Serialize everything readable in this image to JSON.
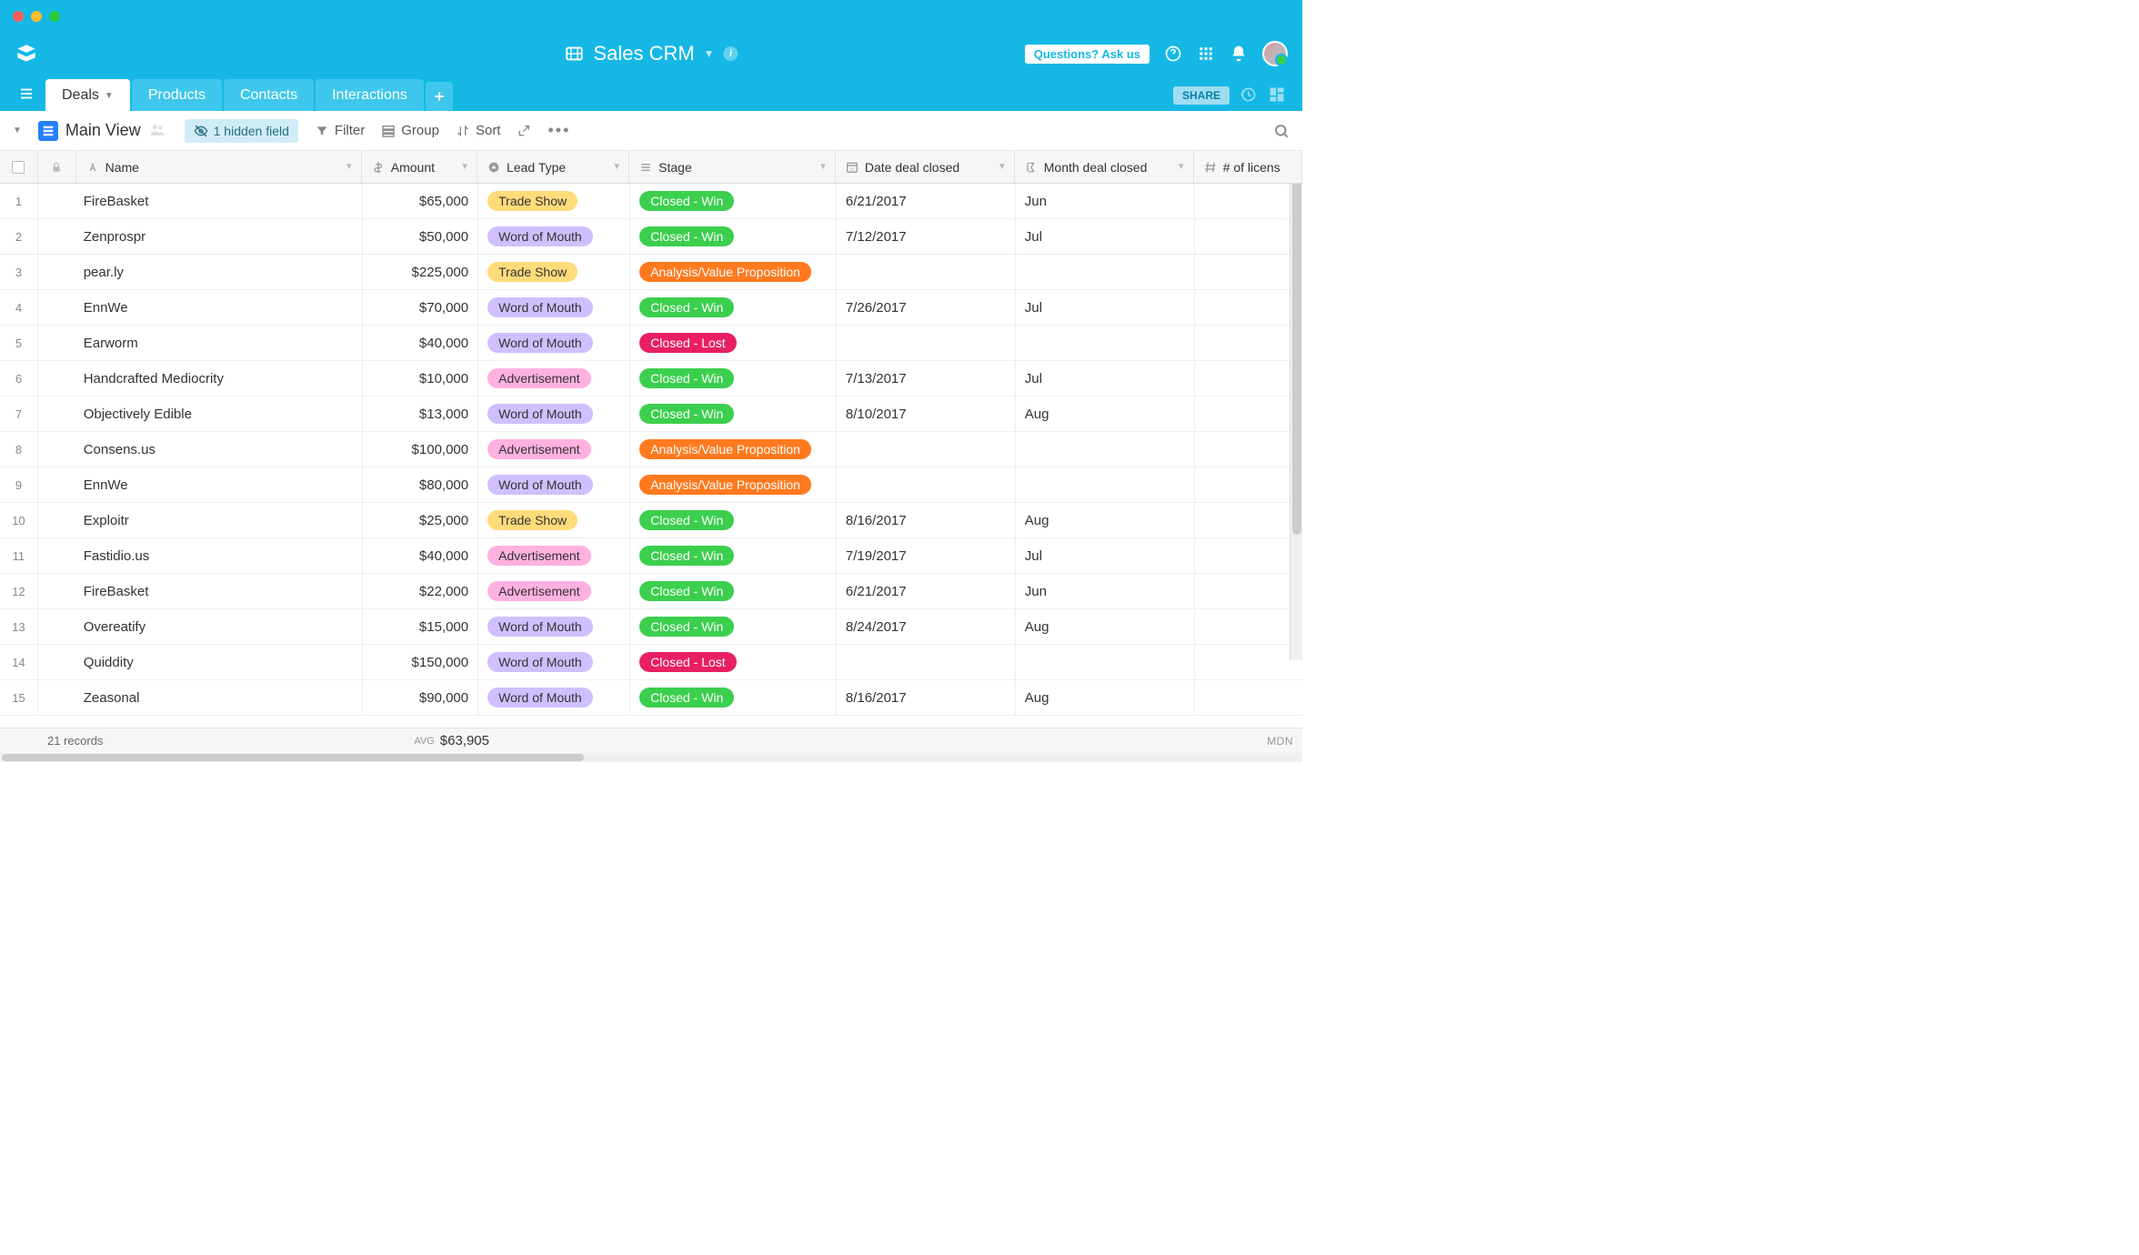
{
  "app_title": "Sales CRM",
  "questions_button": "Questions? Ask us",
  "tabs": [
    "Deals",
    "Products",
    "Contacts",
    "Interactions"
  ],
  "active_tab_index": 0,
  "share_label": "SHARE",
  "view_name": "Main View",
  "toolbar": {
    "hidden_field": "1 hidden field",
    "filter": "Filter",
    "group": "Group",
    "sort": "Sort"
  },
  "columns": {
    "name": "Name",
    "amount": "Amount",
    "lead_type": "Lead Type",
    "stage": "Stage",
    "date_closed": "Date deal closed",
    "month_closed": "Month deal closed",
    "licenses": "# of licens"
  },
  "lead_types": {
    "trade_show": {
      "label": "Trade Show",
      "color": "pill-yellow"
    },
    "word_of_mouth": {
      "label": "Word of Mouth",
      "color": "pill-purple"
    },
    "advertisement": {
      "label": "Advertisement",
      "color": "pill-pink"
    }
  },
  "stages": {
    "closed_win": {
      "label": "Closed ‑ Win",
      "color": "pill-green"
    },
    "closed_lost": {
      "label": "Closed ‑ Lost",
      "color": "pill-red"
    },
    "analysis": {
      "label": "Analysis/Value Proposition",
      "color": "pill-orange"
    }
  },
  "rows": [
    {
      "n": 1,
      "name": "FireBasket",
      "amount": "$65,000",
      "lead": "trade_show",
      "stage": "closed_win",
      "date": "6/21/2017",
      "month": "Jun"
    },
    {
      "n": 2,
      "name": "Zenprospr",
      "amount": "$50,000",
      "lead": "word_of_mouth",
      "stage": "closed_win",
      "date": "7/12/2017",
      "month": "Jul"
    },
    {
      "n": 3,
      "name": "pear.ly",
      "amount": "$225,000",
      "lead": "trade_show",
      "stage": "analysis",
      "date": "",
      "month": ""
    },
    {
      "n": 4,
      "name": "EnnWe",
      "amount": "$70,000",
      "lead": "word_of_mouth",
      "stage": "closed_win",
      "date": "7/26/2017",
      "month": "Jul"
    },
    {
      "n": 5,
      "name": "Earworm",
      "amount": "$40,000",
      "lead": "word_of_mouth",
      "stage": "closed_lost",
      "date": "",
      "month": ""
    },
    {
      "n": 6,
      "name": "Handcrafted Mediocrity",
      "amount": "$10,000",
      "lead": "advertisement",
      "stage": "closed_win",
      "date": "7/13/2017",
      "month": "Jul"
    },
    {
      "n": 7,
      "name": "Objectively Edible",
      "amount": "$13,000",
      "lead": "word_of_mouth",
      "stage": "closed_win",
      "date": "8/10/2017",
      "month": "Aug"
    },
    {
      "n": 8,
      "name": "Consens.us",
      "amount": "$100,000",
      "lead": "advertisement",
      "stage": "analysis",
      "date": "",
      "month": ""
    },
    {
      "n": 9,
      "name": "EnnWe",
      "amount": "$80,000",
      "lead": "word_of_mouth",
      "stage": "analysis",
      "date": "",
      "month": ""
    },
    {
      "n": 10,
      "name": "Exploitr",
      "amount": "$25,000",
      "lead": "trade_show",
      "stage": "closed_win",
      "date": "8/16/2017",
      "month": "Aug"
    },
    {
      "n": 11,
      "name": "Fastidio.us",
      "amount": "$40,000",
      "lead": "advertisement",
      "stage": "closed_win",
      "date": "7/19/2017",
      "month": "Jul"
    },
    {
      "n": 12,
      "name": "FireBasket",
      "amount": "$22,000",
      "lead": "advertisement",
      "stage": "closed_win",
      "date": "6/21/2017",
      "month": "Jun"
    },
    {
      "n": 13,
      "name": "Overeatify",
      "amount": "$15,000",
      "lead": "word_of_mouth",
      "stage": "closed_win",
      "date": "8/24/2017",
      "month": "Aug"
    },
    {
      "n": 14,
      "name": "Quiddity",
      "amount": "$150,000",
      "lead": "word_of_mouth",
      "stage": "closed_lost",
      "date": "",
      "month": ""
    },
    {
      "n": 15,
      "name": "Zeasonal",
      "amount": "$90,000",
      "lead": "word_of_mouth",
      "stage": "closed_win",
      "date": "8/16/2017",
      "month": "Aug"
    }
  ],
  "footer": {
    "record_count": "21 records",
    "avg_label": "AVG",
    "avg_amount": "$63,905",
    "brand": "MDN"
  }
}
